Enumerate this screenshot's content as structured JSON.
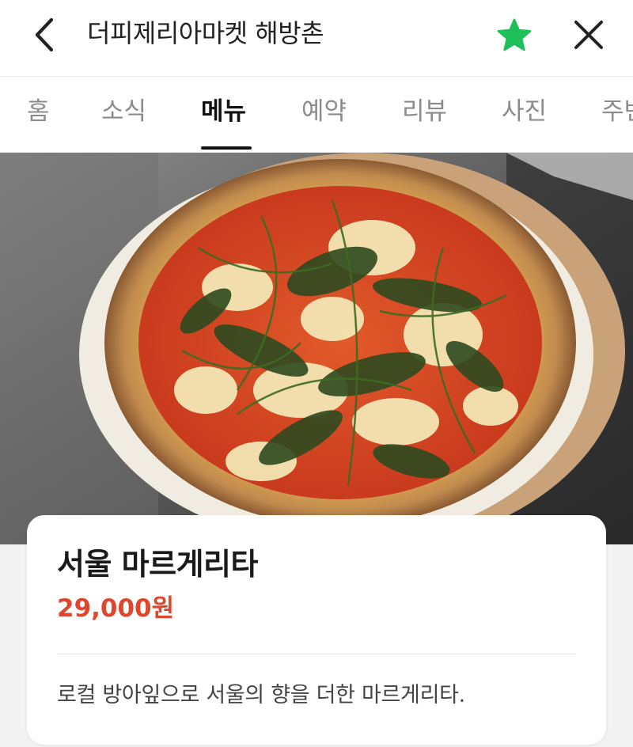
{
  "header": {
    "title": "더피제리아마켓 해방촌",
    "back_icon": "chevron-left-icon",
    "favorite_icon": "star-icon",
    "close_icon": "close-icon",
    "favorite_color": "#1fbf5a"
  },
  "tabs": [
    {
      "label": "홈",
      "active": false
    },
    {
      "label": "소식",
      "active": false
    },
    {
      "label": "메뉴",
      "active": true
    },
    {
      "label": "예약",
      "active": false
    },
    {
      "label": "리뷰",
      "active": false
    },
    {
      "label": "사진",
      "active": false
    },
    {
      "label": "주변",
      "active": false
    }
  ],
  "menu_item": {
    "name": "서울 마르게리타",
    "price": "29,000원",
    "description": "로컬 방아잎으로 서울의 향을 더한 마르게리타.",
    "price_color": "#e0462b"
  }
}
